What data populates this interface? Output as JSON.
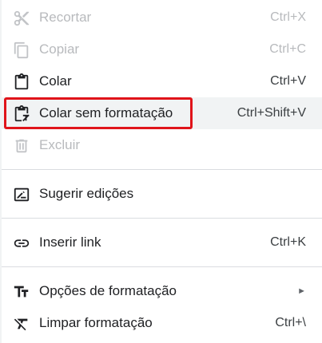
{
  "menu": {
    "items": [
      {
        "label": "Recortar",
        "shortcut": "Ctrl+X",
        "icon": "scissors-icon",
        "disabled": true
      },
      {
        "label": "Copiar",
        "shortcut": "Ctrl+C",
        "icon": "copy-icon",
        "disabled": true
      },
      {
        "label": "Colar",
        "shortcut": "Ctrl+V",
        "icon": "clipboard-icon",
        "disabled": false
      },
      {
        "label": "Colar sem formatação",
        "shortcut": "Ctrl+Shift+V",
        "icon": "paste-without-formatting-icon",
        "disabled": false,
        "highlighted": true
      },
      {
        "label": "Excluir",
        "shortcut": "",
        "icon": "trash-icon",
        "disabled": true
      },
      {
        "label": "Sugerir edições",
        "shortcut": "",
        "icon": "suggest-edit-icon",
        "disabled": false
      },
      {
        "label": "Inserir link",
        "shortcut": "Ctrl+K",
        "icon": "link-icon",
        "disabled": false
      },
      {
        "label": "Opções de formatação",
        "submenu_arrow": "►",
        "icon": "text-format-icon",
        "disabled": false
      },
      {
        "label": "Limpar formatação",
        "shortcut": "Ctrl+\\",
        "icon": "clear-formatting-icon",
        "disabled": false
      }
    ]
  },
  "colors": {
    "highlight_bg": "#f1f3f4",
    "focus_outline": "#e0141a",
    "disabled_text": "#b8babd",
    "text": "#202124"
  }
}
